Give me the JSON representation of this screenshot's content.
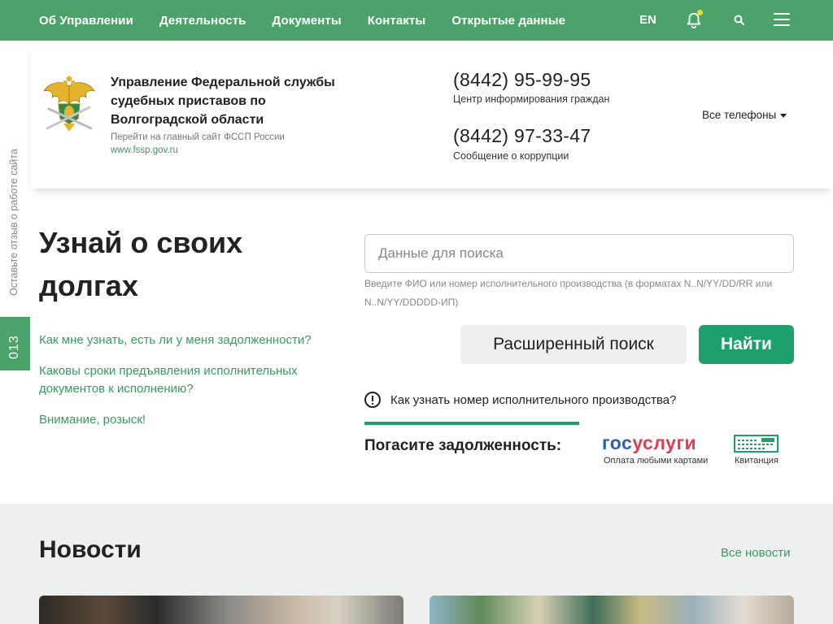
{
  "nav": {
    "links": [
      "Об Управлении",
      "Деятельность",
      "Документы",
      "Контакты",
      "Открытые данные"
    ],
    "lang": "EN",
    "icons": {
      "bell": "bell-icon",
      "search": "search-icon",
      "menu": "menu-icon"
    }
  },
  "header": {
    "org_title": "Управление Федеральной службы судебных приставов по Волгоградской области",
    "org_sub": "Перейти на главный сайт ФССП России",
    "org_link": "www.fssp.gov.ru",
    "phones": [
      {
        "number": "(8442) 95-99-95",
        "caption": "Центр информирования граждан"
      },
      {
        "number": "(8442) 97-33-47",
        "caption": "Сообщение о коррупции"
      }
    ],
    "all_phones": "Все телефоны"
  },
  "side": {
    "feedback": "Оставьте отзыв о работе сайта",
    "tab": "013"
  },
  "debt": {
    "title": "Узнай о своих долгах",
    "faq": [
      "Как мне узнать, есть ли у меня задолженности?",
      "Каковы сроки предъявления исполнительных документов к исполнению?",
      "Внимание, розыск!"
    ],
    "search_placeholder": "Данные для поиска",
    "hint": "Введите ФИО или номер исполнительного производства (в форматах N..N/YY/DD/RR или N..N/YY/DDDDD-ИП)",
    "advanced_button": "Расширенный поиск",
    "find_button": "Найти",
    "howto": "Как узнать номер исполнительного производства?",
    "pay_label": "Погасите задолженность:",
    "gosuslugi_logo_a": "гос",
    "gosuslugi_logo_b": "услуги",
    "gosuslugi_caption": "Оплата любыми картами",
    "receipt_caption": "Квитанция"
  },
  "news": {
    "title": "Новости",
    "all_link": "Все новости"
  },
  "colors": {
    "brand_green": "#4ca36a",
    "button_green": "#1ea06a",
    "link_green": "#3a9a5e",
    "gos_blue": "#2a5fb8",
    "gos_red": "#e8384f"
  }
}
